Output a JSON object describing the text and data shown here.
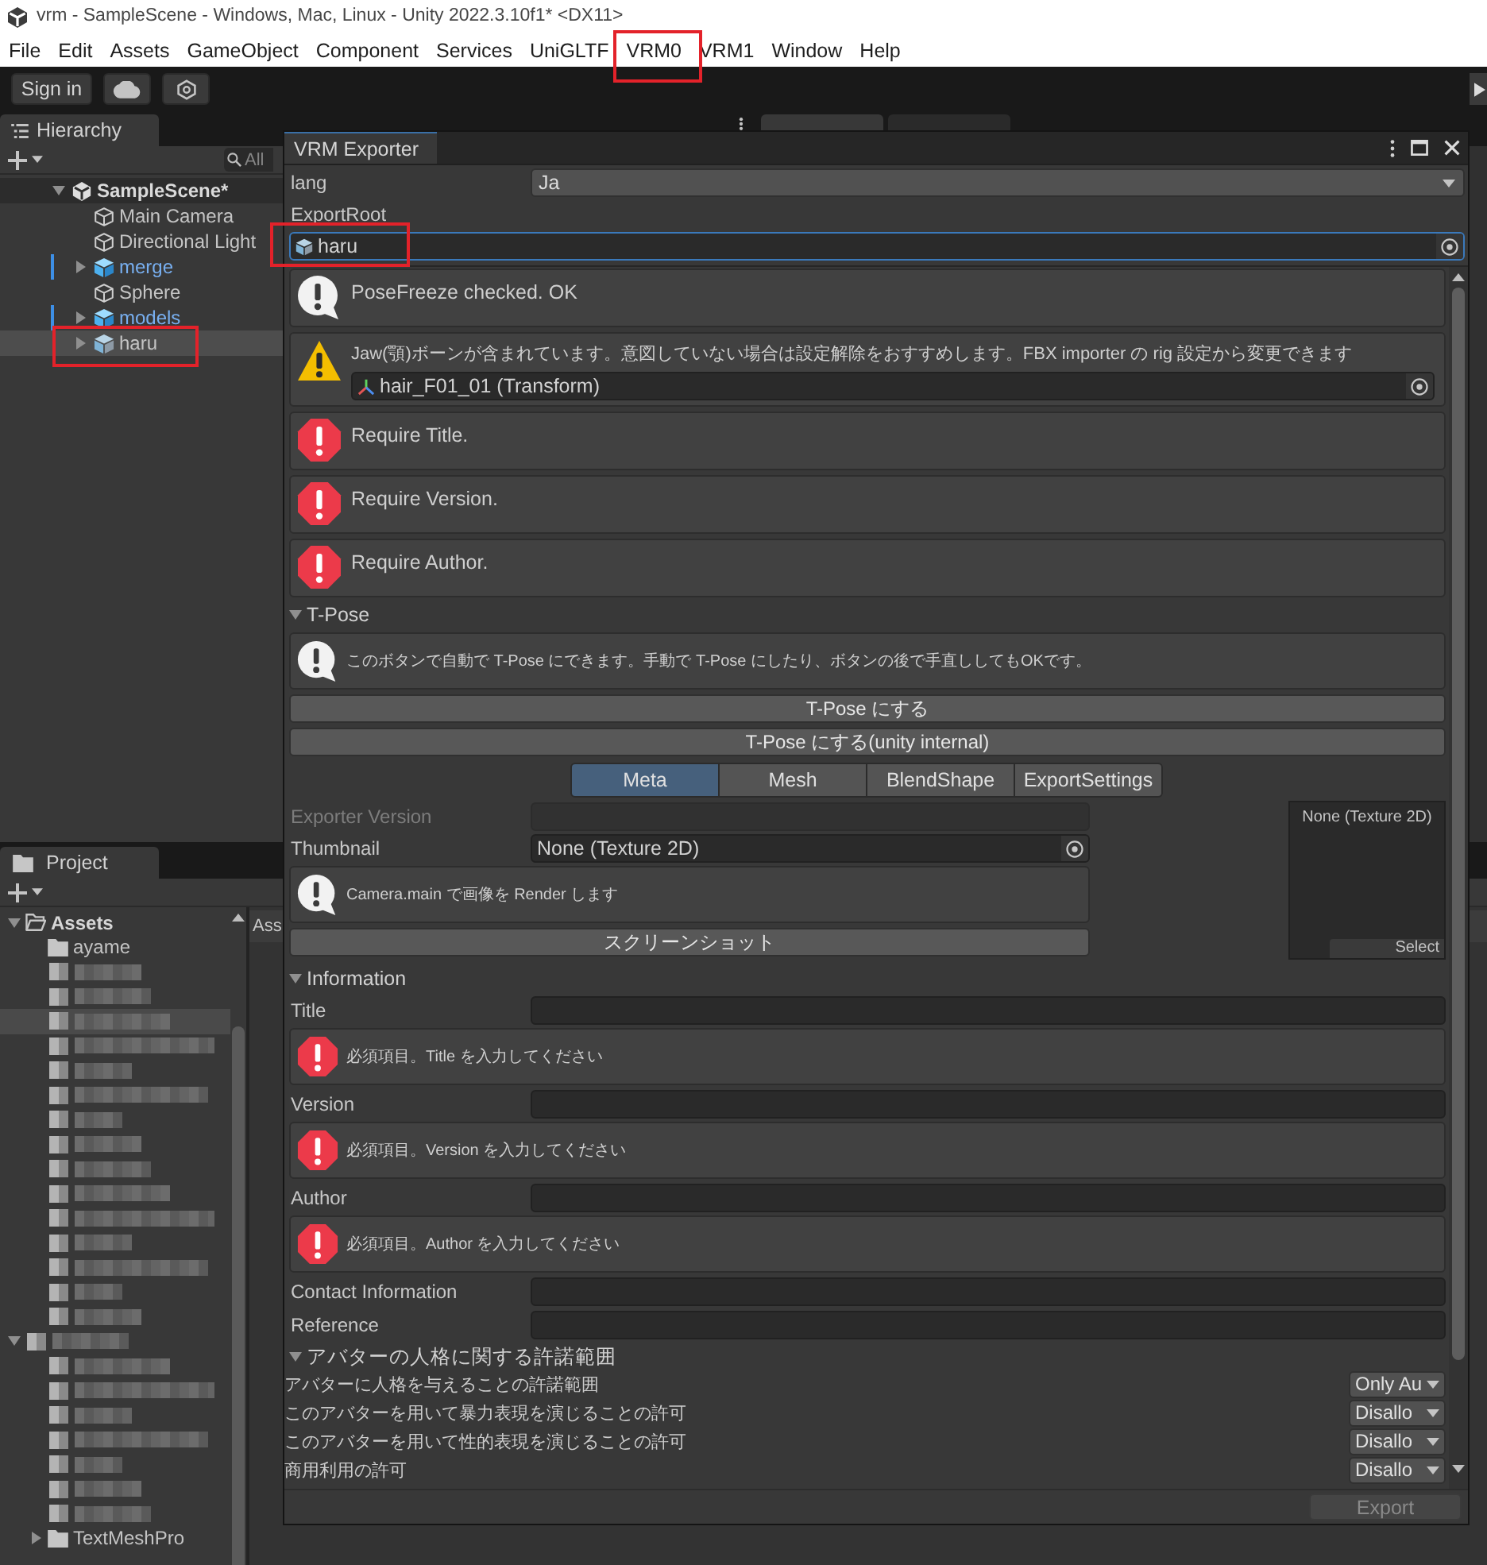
{
  "window": {
    "title": "vrm - SampleScene - Windows, Mac, Linux - Unity 2022.3.10f1* <DX11>"
  },
  "menu": [
    {
      "label": "File",
      "highlighted": false
    },
    {
      "label": "Edit",
      "highlighted": false
    },
    {
      "label": "Assets",
      "highlighted": false
    },
    {
      "label": "GameObject",
      "highlighted": false
    },
    {
      "label": "Component",
      "highlighted": false
    },
    {
      "label": "Services",
      "highlighted": false
    },
    {
      "label": "UniGLTF",
      "highlighted": false
    },
    {
      "label": "VRM0",
      "highlighted": true
    },
    {
      "label": "VRM1",
      "highlighted": false
    },
    {
      "label": "Window",
      "highlighted": false
    },
    {
      "label": "Help",
      "highlighted": false
    }
  ],
  "toolbar": {
    "sign_in": "Sign in"
  },
  "hierarchy": {
    "tab": "Hierarchy",
    "search": {
      "placeholder": "All"
    },
    "items": [
      {
        "label": "SampleScene*",
        "kind": "scene",
        "expanded": true,
        "selected": false,
        "overridden": false,
        "highlighted": false,
        "children": [
          {
            "label": "Main Camera",
            "kind": "object",
            "selected": false,
            "overridden": false,
            "highlighted": false
          },
          {
            "label": "Directional Light",
            "kind": "object",
            "selected": false,
            "overridden": false,
            "highlighted": false
          },
          {
            "label": "merge",
            "kind": "prefab",
            "expanded": false,
            "selected": false,
            "overridden": true,
            "highlighted": false
          },
          {
            "label": "Sphere",
            "kind": "object",
            "selected": false,
            "overridden": false,
            "highlighted": false
          },
          {
            "label": "models",
            "kind": "prefab",
            "expanded": false,
            "selected": false,
            "overridden": true,
            "highlighted": false
          },
          {
            "label": "haru",
            "kind": "model",
            "expanded": false,
            "selected": true,
            "overridden": false,
            "highlighted": true
          }
        ]
      }
    ]
  },
  "project": {
    "tab": "Project",
    "breadcrumb": "Ass",
    "items": [
      {
        "label": "Assets",
        "kind": "folder",
        "expanded": true,
        "selected": false,
        "children": [
          {
            "label": "ayame",
            "kind": "folder",
            "selected": false
          },
          {
            "kind": "redacted",
            "selected": false
          },
          {
            "kind": "redacted",
            "selected": false
          },
          {
            "kind": "redacted",
            "selected": true
          },
          {
            "kind": "redacted",
            "selected": false
          },
          {
            "kind": "redacted",
            "selected": false
          },
          {
            "kind": "redacted",
            "selected": false
          },
          {
            "kind": "redacted",
            "selected": false
          },
          {
            "kind": "redacted",
            "selected": false
          },
          {
            "kind": "redacted",
            "selected": false
          },
          {
            "kind": "redacted",
            "selected": false
          },
          {
            "kind": "redacted",
            "selected": false
          },
          {
            "kind": "redacted",
            "selected": false
          },
          {
            "kind": "redacted",
            "selected": false
          },
          {
            "kind": "redacted",
            "selected": false
          },
          {
            "kind": "redacted",
            "selected": false
          }
        ]
      },
      {
        "kind": "redacted",
        "expanded": true,
        "selected": false,
        "children": [
          {
            "kind": "redacted",
            "selected": false
          },
          {
            "kind": "redacted",
            "selected": false
          },
          {
            "kind": "redacted",
            "selected": false
          },
          {
            "kind": "redacted",
            "selected": false
          },
          {
            "kind": "redacted",
            "selected": false
          },
          {
            "kind": "redacted",
            "selected": false
          },
          {
            "kind": "redacted",
            "selected": false
          },
          {
            "label": "TextMeshPro",
            "kind": "folder",
            "expanded": false,
            "selected": false
          }
        ]
      }
    ]
  },
  "exporter": {
    "title": "VRM Exporter",
    "lang": {
      "label": "lang",
      "value": "Ja"
    },
    "export_root": {
      "label": "ExportRoot",
      "value": "haru",
      "focused": true,
      "highlighted": true
    },
    "messages": [
      {
        "kind": "info",
        "text": "PoseFreeze checked. OK"
      },
      {
        "kind": "warning",
        "text": "Jaw(顎)ボーンが含まれています。意図していない場合は設定解除をおすすめします。FBX importer の rig 設定から変更できます",
        "object": "hair_F01_01 (Transform)"
      },
      {
        "kind": "error",
        "text": "Require Title."
      },
      {
        "kind": "error",
        "text": "Require Version."
      },
      {
        "kind": "error",
        "text": "Require Author."
      }
    ],
    "tpose": {
      "title": "T-Pose",
      "expanded": true,
      "message": {
        "kind": "info",
        "text": "このボタンで自動で T-Pose にできます。手動で T-Pose にしたり、ボタンの後で手直ししてもOKです。"
      },
      "buttons": [
        "T-Pose にする",
        "T-Pose にする(unity internal)"
      ]
    },
    "tabs": [
      {
        "label": "Meta",
        "selected": true
      },
      {
        "label": "Mesh",
        "selected": false
      },
      {
        "label": "BlendShape",
        "selected": false
      },
      {
        "label": "ExportSettings",
        "selected": false
      }
    ],
    "meta": {
      "exporter_version": {
        "label": "Exporter Version",
        "disabled": true
      },
      "thumbnail": {
        "label": "Thumbnail",
        "value": "None (Texture 2D)"
      },
      "preview": {
        "caption": "None (Texture 2D)",
        "button": "Select"
      },
      "message": {
        "kind": "info",
        "text": "Camera.main で画像を Render します"
      },
      "screenshot_button": "スクリーンショット"
    },
    "information": {
      "title": "Information",
      "expanded": true,
      "fields": [
        {
          "label": "Title",
          "message": {
            "kind": "error",
            "text": "必須項目。Title を入力してください"
          }
        },
        {
          "label": "Version",
          "message": {
            "kind": "error",
            "text": "必須項目。Version を入力してください"
          }
        },
        {
          "label": "Author",
          "message": {
            "kind": "error",
            "text": "必須項目。Author を入力してください"
          }
        },
        {
          "label": "Contact Information"
        },
        {
          "label": "Reference"
        }
      ]
    },
    "permissions": {
      "title": "アバターの人格に関する許諾範囲",
      "expanded": true,
      "rows": [
        {
          "label": "アバターに人格を与えることの許諾範囲",
          "value": "Only Au"
        },
        {
          "label": "このアバターを用いて暴力表現を演じることの許可",
          "value": "Disallo"
        },
        {
          "label": "このアバターを用いて性的表現を演じることの許可",
          "value": "Disallo"
        },
        {
          "label": "商用利用の許可",
          "value": "Disallo"
        }
      ]
    },
    "export_button": {
      "label": "Export",
      "disabled": true
    }
  }
}
